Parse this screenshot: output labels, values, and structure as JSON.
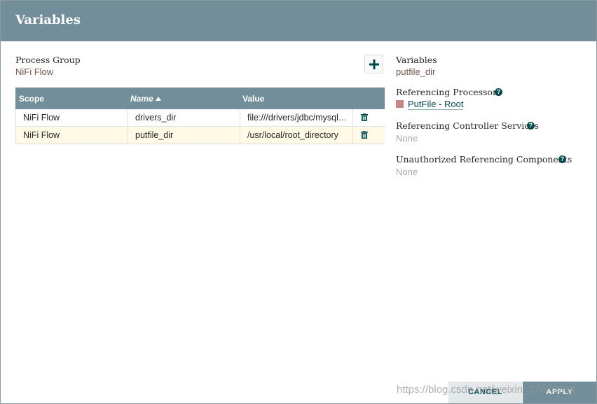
{
  "dialog": {
    "title": "Variables"
  },
  "process_group": {
    "label": "Process Group",
    "value": "NiFi Flow"
  },
  "table": {
    "columns": {
      "scope": "Scope",
      "name": "Name",
      "value": "Value"
    },
    "sort": "Name ascending",
    "rows": [
      {
        "scope": "NiFi Flow",
        "name": "drivers_dir",
        "value": "file:///drivers/jdbc/mysql-connector-java.jar",
        "selected": false
      },
      {
        "scope": "NiFi Flow",
        "name": "putfile_dir",
        "value": "/usr/local/root_directory",
        "selected": true
      }
    ]
  },
  "details": {
    "variables_label": "Variables",
    "variables_value": "putfile_dir",
    "ref_processors_label": "Referencing Processors",
    "ref_processor_name": "PutFile - Root",
    "ref_controller_label": "Referencing Controller Services",
    "ref_controller_value": "None",
    "unauth_label": "Unauthorized Referencing Components",
    "unauth_value": "None",
    "help_glyph": "?"
  },
  "footer": {
    "cancel_label": "CANCEL",
    "apply_label": "APPLY"
  },
  "watermark": "https://blog.csdn.net/weixin_37673308",
  "colors": {
    "header": "#728e9b",
    "accent_dark": "#004849",
    "value_text": "#775351",
    "selected_row": "#fffae6",
    "processor_swatch": "#c98686"
  },
  "icons": {
    "add": "plus-icon",
    "delete": "trash-icon",
    "help": "help-icon",
    "sort": "sort-ascending-icon"
  }
}
